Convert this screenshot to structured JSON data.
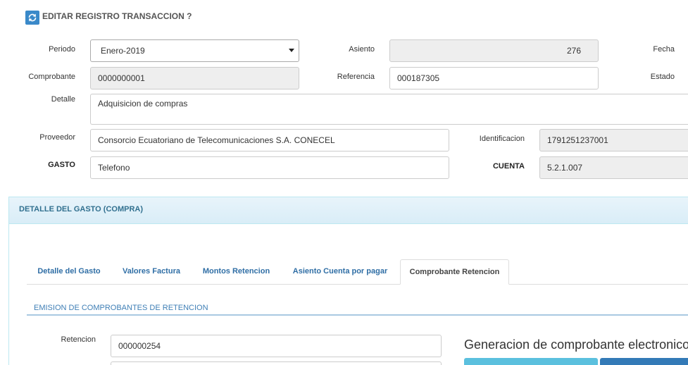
{
  "header": {
    "icon": "refresh-icon",
    "title": "EDITAR REGISTRO TRANSACCION ?"
  },
  "form": {
    "periodo": {
      "label": "Periodo",
      "value": "Enero-2019"
    },
    "asiento": {
      "label": "Asiento",
      "value": "276"
    },
    "fecha": {
      "label": "Fecha"
    },
    "comprobante": {
      "label": "Comprobante",
      "value": "0000000001"
    },
    "referencia": {
      "label": "Referencia",
      "value": "000187305"
    },
    "estado": {
      "label": "Estado"
    },
    "detalle": {
      "label": "Detalle",
      "value": "Adquisicion de compras"
    },
    "proveedor": {
      "label": "Proveedor",
      "value": "Consorcio Ecuatoriano de Telecomunicaciones S.A. CONECEL"
    },
    "identificacion": {
      "label": "Identificacion",
      "value": "1791251237001"
    },
    "gasto": {
      "label": "GASTO",
      "value": "Telefono"
    },
    "cuenta": {
      "label": "CUENTA",
      "value": "5.2.1.007"
    }
  },
  "panel": {
    "title": "DETALLE DEL GASTO (COMPRA)",
    "tabs": [
      {
        "label": "Detalle del Gasto",
        "active": false
      },
      {
        "label": "Valores Factura",
        "active": false
      },
      {
        "label": "Montos Retencion",
        "active": false
      },
      {
        "label": "Asiento Cuenta por pagar",
        "active": false
      },
      {
        "label": "Comprobante Retencion",
        "active": true
      }
    ],
    "section_title": "EMISION DE COMPROBANTES DE RETENCION",
    "retencion": {
      "label": "Retencion",
      "value": "000000254"
    },
    "generacion_title": "Generacion de comprobante electronico"
  },
  "colors": {
    "accent": "#3a89c9",
    "panel_header_bg": "#d9edf7",
    "panel_header_text": "#31708f",
    "panel_border": "#bce8f1",
    "tab_link": "#2f6ea5",
    "section_title": "#3f7fb6",
    "readonly_bg": "#eeeeee",
    "button_info": "#5bc0de",
    "button_primary": "#337ab7"
  }
}
